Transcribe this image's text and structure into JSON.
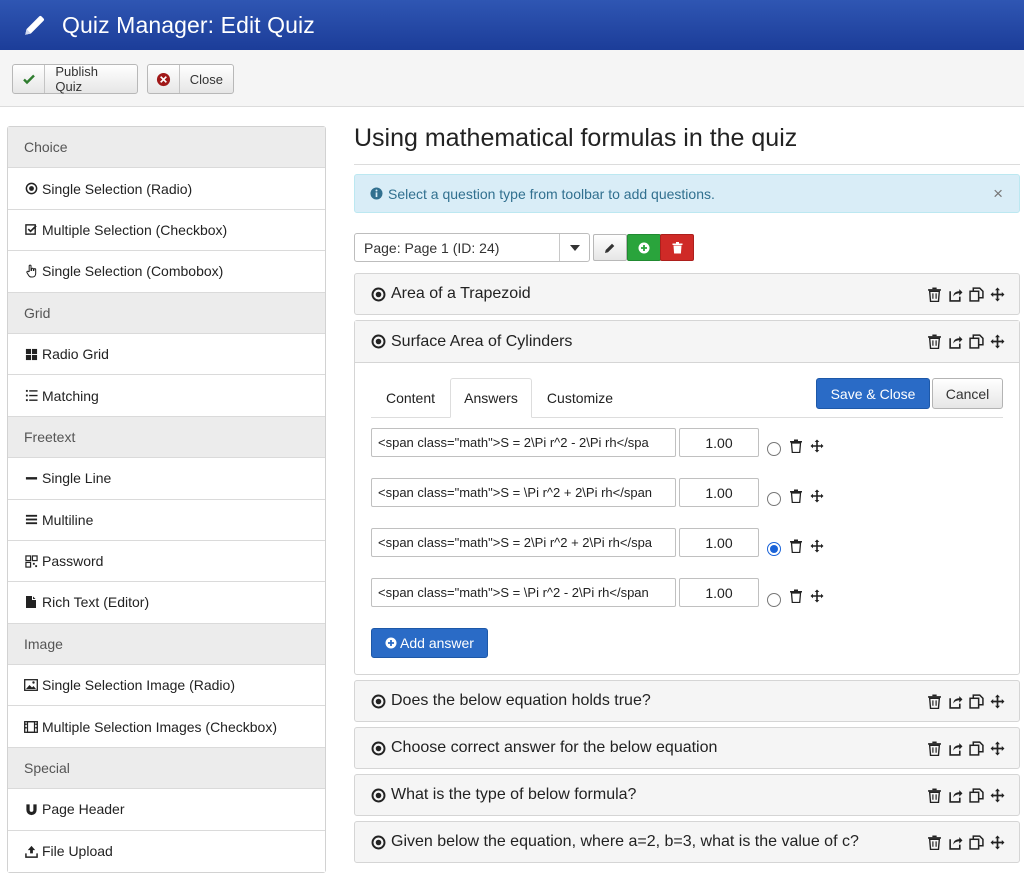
{
  "header": {
    "title": "Quiz Manager: Edit Quiz"
  },
  "toolbar": {
    "publish_label": "Publish Quiz",
    "close_label": "Close"
  },
  "sidebar": {
    "groups": [
      {
        "label": "Choice",
        "items": [
          "Single Selection (Radio)",
          "Multiple Selection (Checkbox)",
          "Single Selection (Combobox)"
        ]
      },
      {
        "label": "Grid",
        "items": [
          "Radio Grid",
          "Matching"
        ]
      },
      {
        "label": "Freetext",
        "items": [
          "Single Line",
          "Multiline",
          "Password",
          "Rich Text (Editor)"
        ]
      },
      {
        "label": "Image",
        "items": [
          "Single Selection Image (Radio)",
          "Multiple Selection Images (Checkbox)"
        ]
      },
      {
        "label": "Special",
        "items": [
          "Page Header",
          "File Upload"
        ]
      }
    ]
  },
  "main": {
    "title": "Using mathematical formulas in the quiz",
    "info": "Select a question type from toolbar to add questions.",
    "close_symbol": "×",
    "page_select": "Page: Page 1 (ID: 24)",
    "questions": [
      "Area of a Trapezoid",
      "Surface Area of Cylinders",
      "Does the below equation holds true?",
      "Choose correct answer for the below equation",
      "What is the type of below formula?",
      "Given below the equation, where a=2, b=3, what is the value of c?"
    ],
    "tabs": [
      "Content",
      "Answers",
      "Customize"
    ],
    "save_close_label": "Save & Close",
    "cancel_label": "Cancel",
    "answers": [
      {
        "text": "<span class=\"math\">S = 2\\Pi r^2 - 2\\Pi rh</spa",
        "score": "1.00",
        "correct": false
      },
      {
        "text": "<span class=\"math\">S = \\Pi r^2 + 2\\Pi rh</span",
        "score": "1.00",
        "correct": false
      },
      {
        "text": "<span class=\"math\">S = 2\\Pi r^2 + 2\\Pi rh</spa",
        "score": "1.00",
        "correct": true
      },
      {
        "text": "<span class=\"math\">S = \\Pi r^2 - 2\\Pi rh</span",
        "score": "1.00",
        "correct": false
      }
    ],
    "add_answer_label": "Add answer"
  },
  "colors": {
    "header": "#2a4fb0",
    "primary": "#2a6bc6",
    "add": "#2aa43c",
    "delete": "#cf2a27",
    "info_bg": "#d9edf7"
  }
}
